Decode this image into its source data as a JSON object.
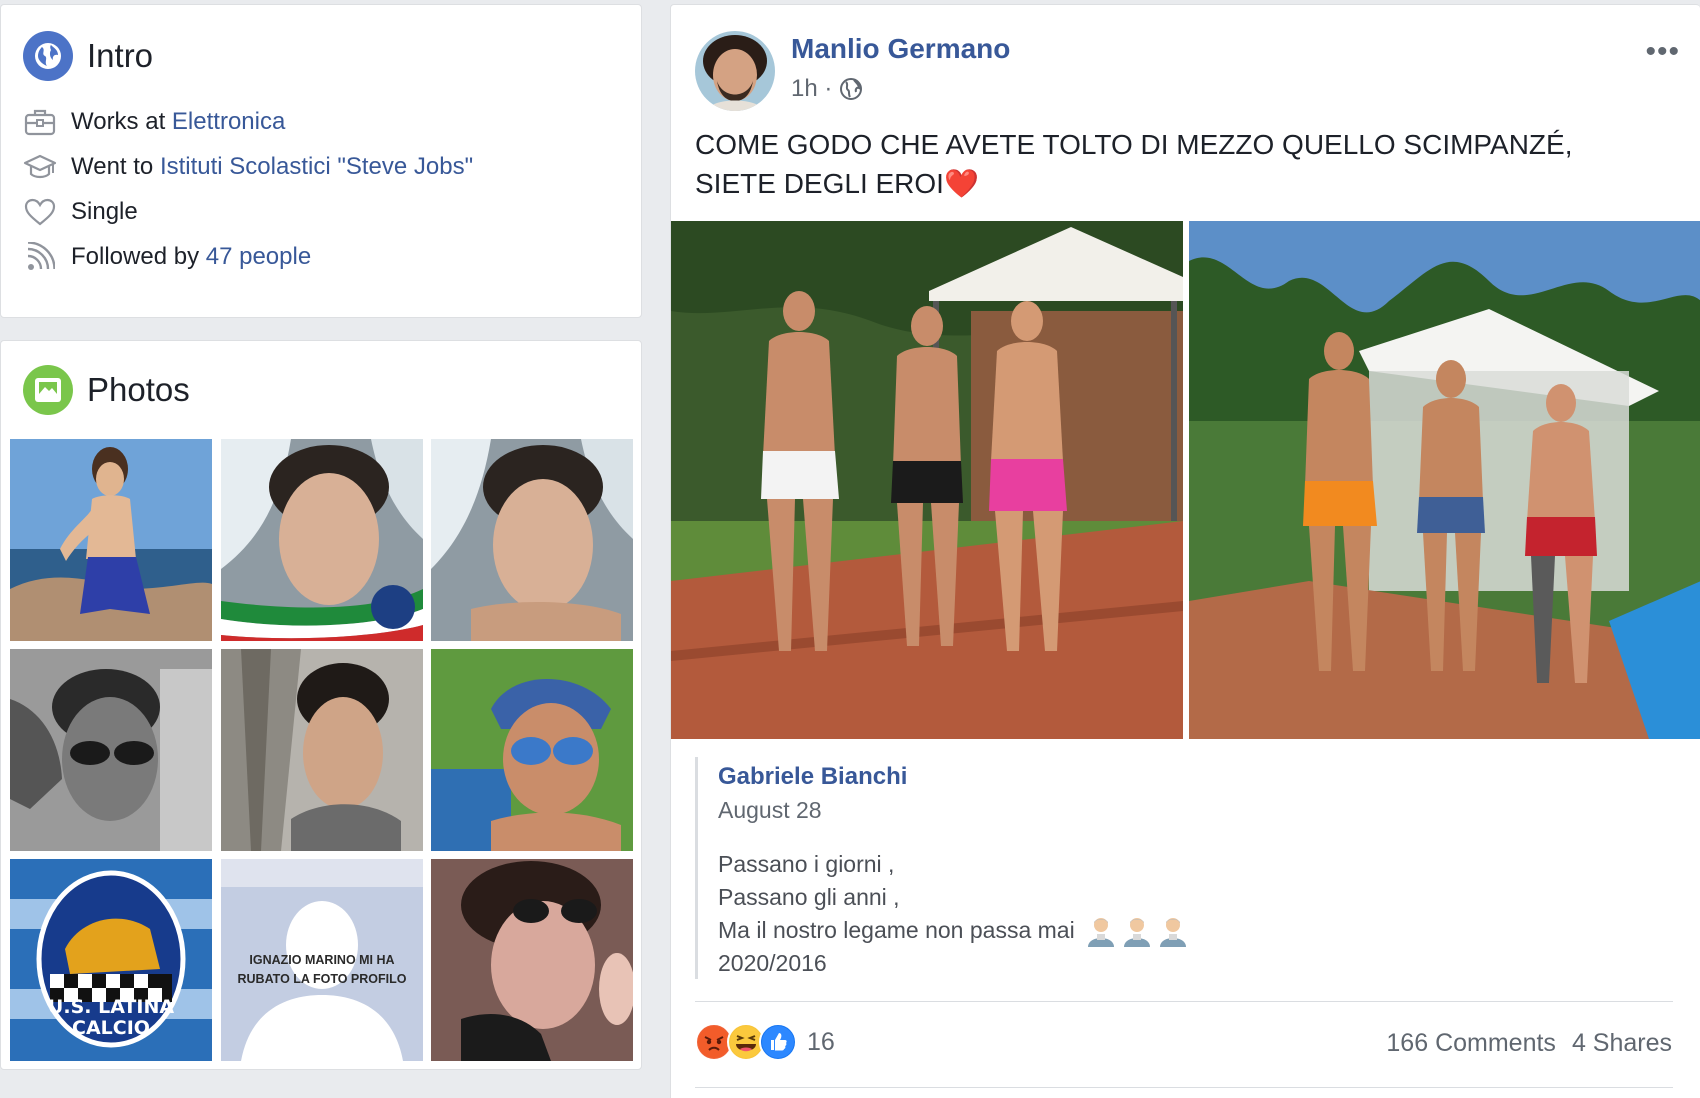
{
  "intro": {
    "title": "Intro",
    "works_prefix": "Works at ",
    "works_link": "Elettronica",
    "went_prefix": "Went to ",
    "went_link": "Istituti Scolastici \"Steve Jobs\"",
    "relationship": "Single",
    "followed_prefix": "Followed by ",
    "followed_link": "47 people"
  },
  "photos": {
    "title": "Photos",
    "tile_8_caption_line1": "IGNAZIO MARINO MI HA",
    "tile_8_caption_line2": "RUBATO LA FOTO PROFILO",
    "tile_7_badge_line1": "U.S. LATINA",
    "tile_7_badge_line2": "CALCIO"
  },
  "post": {
    "author": "Manlio Germano",
    "time": "1h",
    "time_separator": " · ",
    "text": "COME GODO CHE AVETE TOLTO DI MEZZO QUELLO SCIMPANZÉ, SIETE DEGLI EROI",
    "text_emoji": "❤️",
    "shared": {
      "author": "Gabriele Bianchi",
      "date": "August 28",
      "line1": "Passano i giorni ,",
      "line2": "Passano gli anni ,",
      "line3": "Ma il nostro legame non passa mai",
      "line4": "2020/2016"
    },
    "reaction_count": "16",
    "comments": "166 Comments",
    "shares": "4 Shares"
  },
  "colors": {
    "link": "#385898",
    "background": "#e9ebee",
    "intro_icon": "#4c73c7",
    "photos_icon": "#7ac64b"
  },
  "icons": {
    "intro": "globe-icon",
    "work": "briefcase-icon",
    "education": "graduation-cap-icon",
    "relationship": "heart-icon",
    "followers": "rss-icon",
    "photos": "photo-icon",
    "audience": "globe-icon",
    "more": "more-options-icon"
  }
}
